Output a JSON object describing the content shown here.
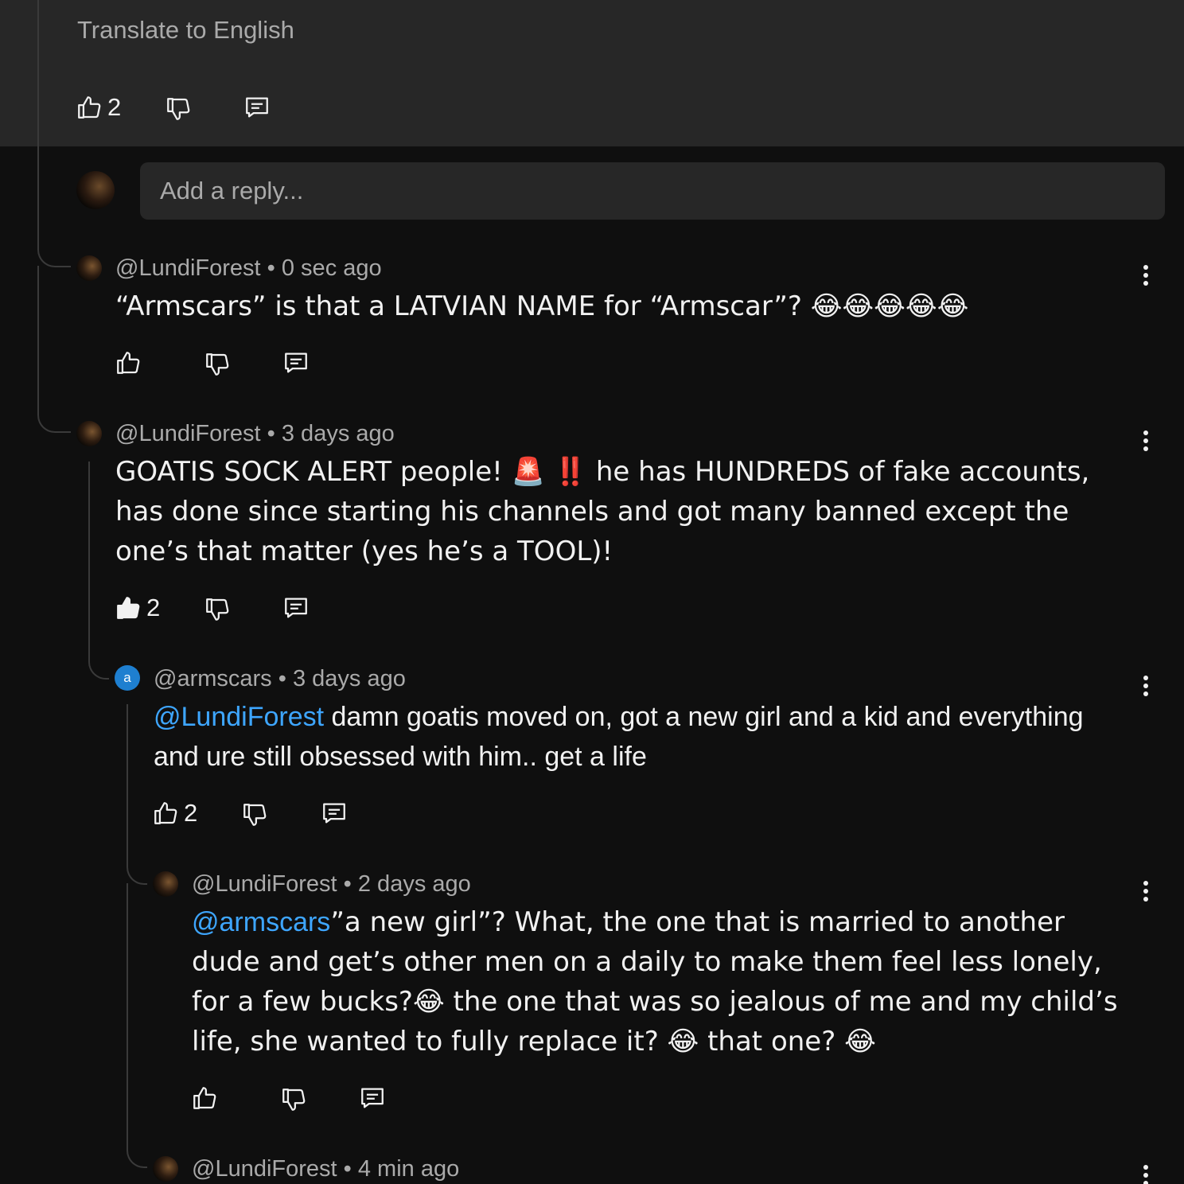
{
  "parent": {
    "translate_label": "Translate to English",
    "like_count": "2"
  },
  "reply_input": {
    "placeholder": "Add a reply..."
  },
  "comments": [
    {
      "author": "@LundiForest",
      "time": "0 sec ago",
      "text": "“Armscars” is that a LATVIAN NAME for “Armscar”? 😂😂😂😂😂",
      "like_count": ""
    },
    {
      "author": "@LundiForest",
      "time": "3 days ago",
      "text": "GOATIS SOCK ALERT people! 🚨 ‼️ he has HUNDREDS of fake accounts, has done since starting his channels and got many banned except the one’s that matter (yes he’s a TOOL)!",
      "like_count": "2"
    },
    {
      "author": "@armscars",
      "avatar_letter": "a",
      "time": "3 days ago",
      "mention": "@LundiForest",
      "text": " damn goatis moved on, got a new girl and a kid and everything and ure still obsessed with him.. get a life",
      "like_count": "2"
    },
    {
      "author": "@LundiForest",
      "time": "2 days ago",
      "mention": "@armscars",
      "text": "”a new girl”? What, the one that is married to another dude and get’s other men on a daily to make them feel less lonely, for a few bucks?😂 the one that was so jealous of me and my child’s life, she wanted to fully replace it? 😂 that one? 😂",
      "like_count": ""
    },
    {
      "author": "@LundiForest",
      "time": "4 min ago"
    }
  ],
  "separator": "•",
  "icons": [
    "thumb-up-icon",
    "thumb-down-icon",
    "reply-icon",
    "more-vert-icon"
  ],
  "colors": {
    "mention": "#3ea6ff",
    "background": "#0f0f0f",
    "highlight": "#272727"
  }
}
